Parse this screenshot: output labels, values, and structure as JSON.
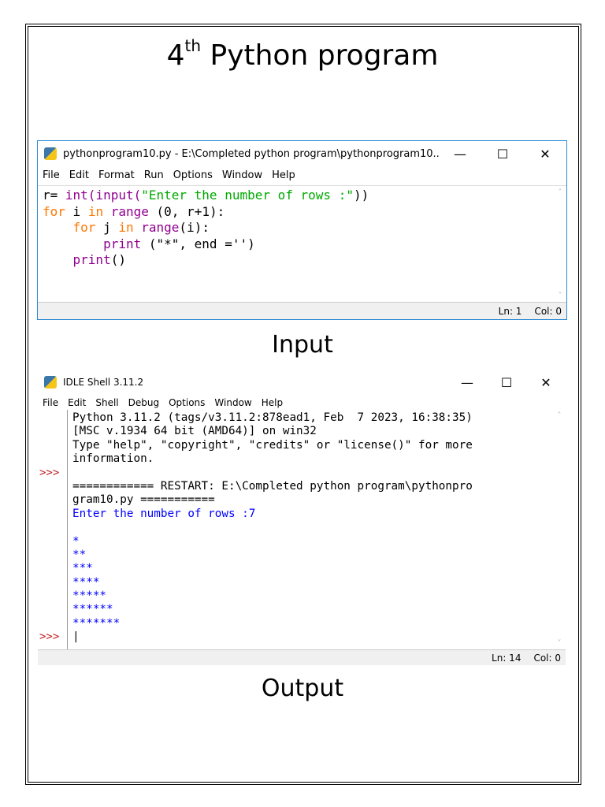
{
  "heading": {
    "number": "4",
    "suffix": "th",
    "text": " Python program"
  },
  "editor": {
    "title": "pythonprogram10.py - E:\\Completed python program\\pythonprogram10...",
    "menu": [
      "File",
      "Edit",
      "Format",
      "Run",
      "Options",
      "Window",
      "Help"
    ],
    "code": [
      [
        [
          "df",
          "r= "
        ],
        [
          "bi",
          "int(input("
        ],
        [
          "st",
          "\"Enter the number of rows :\""
        ],
        [
          "df",
          "))"
        ]
      ],
      [
        [
          "kw",
          "for"
        ],
        [
          "df",
          " i "
        ],
        [
          "kw",
          "in"
        ],
        [
          "df",
          " "
        ],
        [
          "bi",
          "range"
        ],
        [
          "df",
          " (0, r+1):"
        ]
      ],
      [
        [
          "df",
          "    "
        ],
        [
          "kw",
          "for"
        ],
        [
          "df",
          " j "
        ],
        [
          "kw",
          "in"
        ],
        [
          "df",
          " "
        ],
        [
          "bi",
          "range"
        ],
        [
          "df",
          "(i):"
        ]
      ],
      [
        [
          "df",
          "        "
        ],
        [
          "bi",
          "print"
        ],
        [
          "df",
          " (\"*\", end ='')"
        ]
      ],
      [
        [
          "df",
          "    "
        ],
        [
          "bi",
          "print"
        ],
        [
          "df",
          "()"
        ]
      ]
    ],
    "status": {
      "ln": "Ln: 1",
      "col": "Col: 0"
    }
  },
  "input_caption": "Input",
  "shell": {
    "title": "IDLE Shell 3.11.2",
    "menu": [
      "File",
      "Edit",
      "Shell",
      "Debug",
      "Options",
      "Window",
      "Help"
    ],
    "lines": [
      {
        "p": "",
        "t": "Python 3.11.2 (tags/v3.11.2:878ead1, Feb  7 2023, 16:38:35)",
        "c": "df"
      },
      {
        "p": "",
        "t": "[MSC v.1934 64 bit (AMD64)] on win32",
        "c": "df"
      },
      {
        "p": "",
        "t": "Type \"help\", \"copyright\", \"credits\" or \"license()\" for more",
        "c": "df"
      },
      {
        "p": "",
        "t": "information.",
        "c": "df"
      },
      {
        "p": ">>>",
        "t": "",
        "c": "df"
      },
      {
        "p": "",
        "t": "============ RESTART: E:\\Completed python program\\pythonpro",
        "c": "df"
      },
      {
        "p": "",
        "t": "gram10.py ===========",
        "c": "df"
      },
      {
        "p": "",
        "t": "Enter the number of rows :7",
        "c": "out"
      },
      {
        "p": "",
        "t": "",
        "c": "out"
      },
      {
        "p": "",
        "t": "*",
        "c": "out"
      },
      {
        "p": "",
        "t": "**",
        "c": "out"
      },
      {
        "p": "",
        "t": "***",
        "c": "out"
      },
      {
        "p": "",
        "t": "****",
        "c": "out"
      },
      {
        "p": "",
        "t": "*****",
        "c": "out"
      },
      {
        "p": "",
        "t": "******",
        "c": "out"
      },
      {
        "p": "",
        "t": "*******",
        "c": "out"
      },
      {
        "p": ">>>",
        "t": "|",
        "c": "df"
      }
    ],
    "status": {
      "ln": "Ln: 14",
      "col": "Col: 0"
    }
  },
  "output_caption": "Output",
  "controls": {
    "minimize": "—",
    "maximize": "☐",
    "close": "✕"
  }
}
